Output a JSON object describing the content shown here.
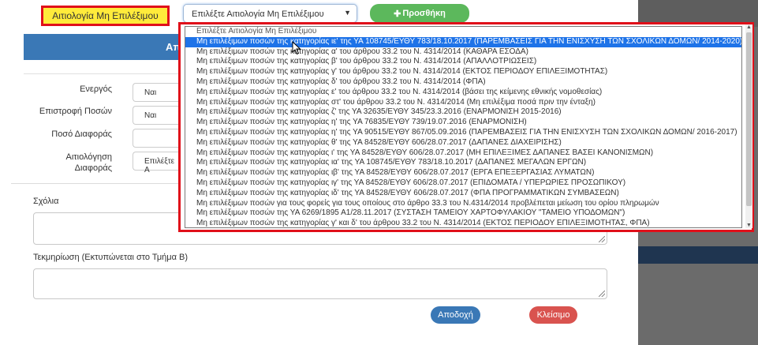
{
  "header": {
    "reason_label": "Αιτιολογία Μη Επιλέξιμου",
    "select_value": "Επιλέξτε Αιτιολογία Μη Επιλέξιμου",
    "add_button": "Προσθήκη",
    "section_title": "Απ"
  },
  "form": {
    "active_label": "Ενεργός",
    "active_value": "Ναι",
    "refund_label": "Επιστροφή Ποσών",
    "refund_value": "Ναι",
    "diff_amount_label": "Ποσό Διαφοράς",
    "diff_reason_label_1": "Αιτιολόγηση",
    "diff_reason_label_2": "Διαφοράς",
    "diff_reason_value": "Επιλέξτε Α"
  },
  "comments_label": "Σχόλια",
  "justification_label": "Τεκμηρίωση (Εκτυπώνεται στο Τμήμα Β)",
  "footer": {
    "accept": "Αποδοχή",
    "close": "Κλείσιμο"
  },
  "dropdown": {
    "options": [
      "Επιλέξτε Αιτιολογία Μη Επιλέξιμου",
      "Μη επιλέξιμων ποσών της κατηγορίας ιε' της ΥΑ 108745/ΕΥΘΥ 783/18.10.2017 (ΠΑΡΕΜΒΑΣΕΙΣ ΓΙΑ ΤΗΝ ΕΝΙΣΧΥΣΗ ΤΩΝ ΣΧΟΛΙΚΩΝ ΔΟΜΩΝ/ 2014-2020)",
      "Μη επιλέξιμων ποσών της κατηγορίας α' του άρθρου 33.2 του Ν. 4314/2014 (ΚΑΘΑΡΑ ΕΣΟΔΑ)",
      "Μη επιλέξιμων ποσών της κατηγορίας β' του άρθρου 33.2 του Ν. 4314/2014 (ΑΠΑΛΛΟΤΡΙΩΣΕΙΣ)",
      "Μη επιλέξιμων ποσών της κατηγορίας γ' του άρθρου 33.2 του Ν. 4314/2014 (ΕΚΤΟΣ ΠΕΡΙΟΔΟΥ ΕΠΙΛΕΞΙΜΟΤΗΤΑΣ)",
      "Μη επιλέξιμων ποσών της κατηγορίας δ' του άρθρου 33.2 του Ν. 4314/2014 (ΦΠΑ)",
      "Μη επιλέξιμων ποσών της κατηγορίας ε' του άρθρου 33.2 του Ν. 4314/2014 (βάσει της κείμενης εθνικής νομοθεσίας)",
      "Μη επιλέξιμων ποσών της κατηγορίας στ' του άρθρου 33.2 του Ν. 4314/2014 (Μη επιλέξιμα ποσά πριν την ένταξη)",
      "Μη επιλέξιμων ποσών της κατηγορίας ζ' της ΥΑ 32635/ΕΥΘΥ 345/23.3.2016 (ΕΝΑΡΜΟΝΙΣΗ 2015-2016)",
      "Μη επιλέξιμων ποσών της κατηγορίας η' της ΥΑ 76835/ΕΥΘΥ 739/19.07.2016 (ΕΝΑΡΜΟΝΙΣΗ)",
      "Μη επιλέξιμων ποσών της κατηγορίας η' της ΥΑ 90515/ΕΥΘΥ 867/05.09.2016 (ΠΑΡΕΜΒΑΣΕΙΣ ΓΙΑ ΤΗΝ ΕΝΙΣΧΥΣΗ ΤΩΝ ΣΧΟΛΙΚΩΝ ΔΟΜΩΝ/ 2016-2017)",
      "Μη επιλέξιμων ποσών της κατηγορίας θ' της ΥΑ 84528/ΕΥΘΥ 606/28.07.2017 (ΔΑΠΑΝΕΣ ΔΙΑΧΕΙΡΙΣΗΣ)",
      "Μη επιλέξιμων ποσών της κατηγορίας ι' της ΥΑ 84528/ΕΥΘΥ 606/28.07.2017 (ΜΗ ΕΠΙΛΕΞΙΜΕΣ ΔΑΠΑΝΕΣ ΒΑΣΕΙ ΚΑΝΟΝΙΣΜΩΝ)",
      "Μη επιλέξιμων ποσών της κατηγορίας ια' της ΥΑ 108745/ΕΥΘΥ 783/18.10.2017 (ΔΑΠΑΝΕΣ ΜΕΓΑΛΩΝ ΕΡΓΩΝ)",
      "Μη επιλέξιμων ποσών της κατηγορίας ιβ' της ΥΑ 84528/ΕΥΘΥ 606/28.07.2017 (ΕΡΓΑ ΕΠΕΞΕΡΓΑΣΙΑΣ ΛΥΜΑΤΩΝ)",
      "Μη επιλέξιμων ποσών της κατηγορίας ιγ' της ΥΑ 84528/ΕΥΘΥ 606/28.07.2017 (ΕΠΙΔΟΜΑΤΑ / ΥΠΕΡΩΡΙΕΣ ΠΡΟΣΩΠΙΚΟΥ)",
      "Μη επιλέξιμων ποσών της κατηγορίας ιδ' της ΥΑ 84528/ΕΥΘΥ 606/28.07.2017 (ΦΠΑ ΠΡΟΓΡΑΜΜΑΤΙΚΩΝ ΣΥΜΒΑΣΕΩΝ)",
      "Μη επιλέξιμων ποσών για τους φορείς για τους οποίους στο άρθρο 33.3 του Ν.4314/2014 προβλέπεται μείωση του ορίου πληρωμών",
      "Μη επιλέξιμων ποσών της ΥΑ 6269/1895 Α1/28.11.2017 (ΣΥΣΤΑΣΗ ΤΑΜΕΙΟΥ ΧΑΡΤΟΦΥΛΑΚΙΟΥ \"ΤΑΜΕΙΟ ΥΠΟΔΟΜΩΝ\")",
      "Μη επιλέξιμων ποσών της κατηγορίας γ' και δ' του άρθρου 33.2 του Ν. 4314/2014 (ΕΚΤΟΣ ΠΕΡΙΟΔΟΥ ΕΠΙΛΕΞΙΜΟΤΗΤΑΣ, ΦΠΑ)"
    ]
  }
}
